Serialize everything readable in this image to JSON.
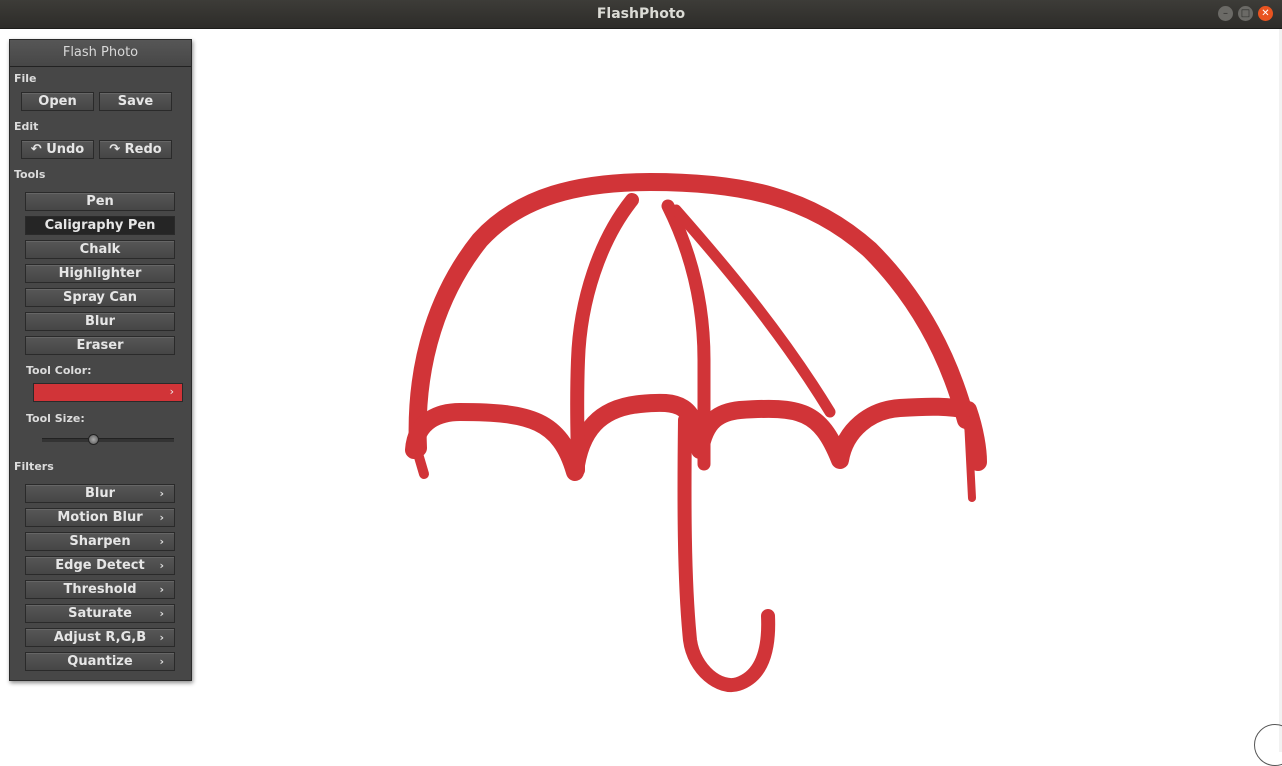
{
  "window": {
    "title": "FlashPhoto"
  },
  "panel": {
    "title": "Flash Photo",
    "file": {
      "label": "File",
      "open": "Open",
      "save": "Save"
    },
    "edit": {
      "label": "Edit",
      "undo": "Undo",
      "redo": "Redo"
    },
    "tools": {
      "label": "Tools",
      "items": [
        "Pen",
        "Caligraphy Pen",
        "Chalk",
        "Highlighter",
        "Spray Can",
        "Blur",
        "Eraser"
      ],
      "selected": "Caligraphy Pen",
      "color_label": "Tool Color:",
      "color": "#d13438",
      "size_label": "Tool Size:",
      "size_fraction": 0.38
    },
    "filters": {
      "label": "Filters",
      "items": [
        "Blur",
        "Motion Blur",
        "Sharpen",
        "Edge Detect",
        "Threshold",
        "Saturate",
        "Adjust R,G,B",
        "Quantize"
      ]
    }
  },
  "canvas": {
    "stroke_color": "#d13438",
    "background": "#ffffff"
  }
}
